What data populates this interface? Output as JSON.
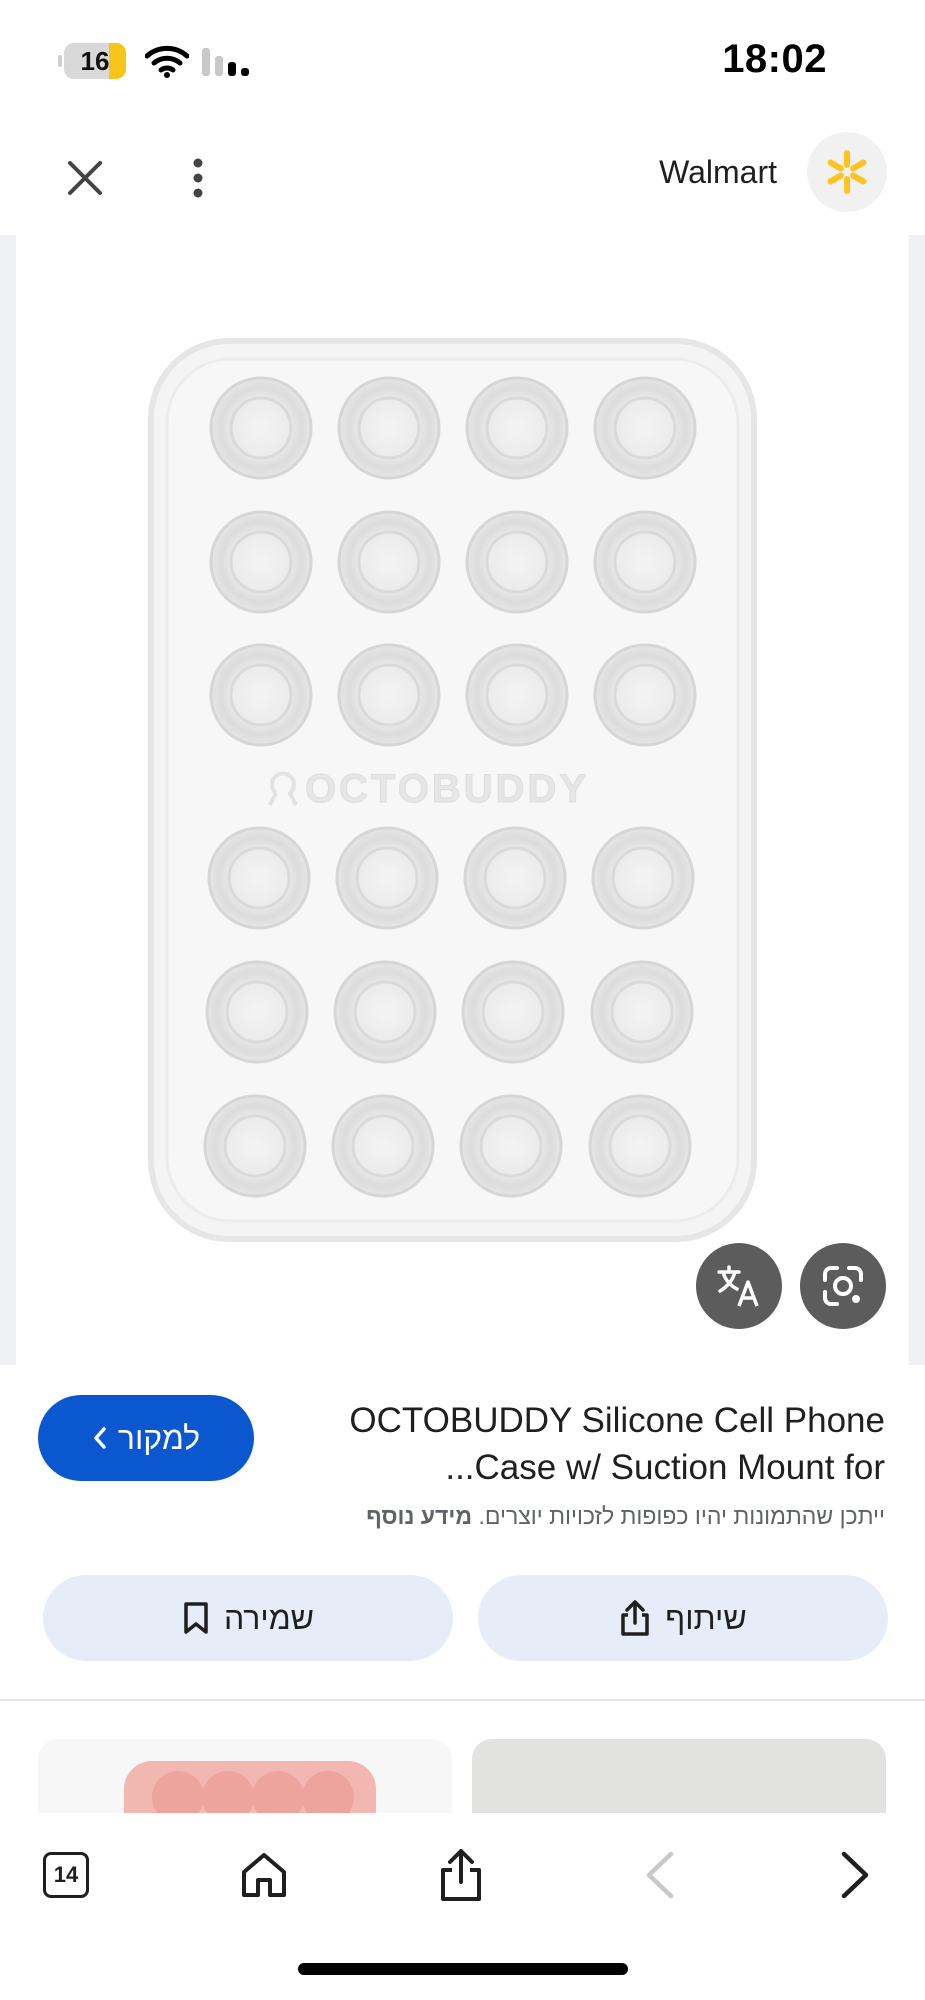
{
  "status_bar": {
    "battery_level": "16",
    "time": "18:02"
  },
  "header": {
    "source_name": "Walmart",
    "close_icon": "close-icon",
    "more_icon": "more-vert-icon",
    "logo_icon": "walmart-spark-icon"
  },
  "image": {
    "brand_text": "OCTOBUDDY",
    "translate_icon": "translate-icon",
    "lens_icon": "google-lens-icon"
  },
  "product": {
    "title_line1": "OCTOBUDDY Silicone Cell Phone",
    "title_line2": "...Case w/ Suction Mount for",
    "visit_label": "למקור",
    "disclaimer_text": "ייתכן שהתמונות יהיו כפופות לזכויות יוצרים.",
    "disclaimer_link": "מידע נוסף",
    "save_label": "שמירה",
    "share_label": "שיתוף"
  },
  "toolbar": {
    "tabs_count": "14",
    "home_icon": "home-icon",
    "share_icon": "share-icon",
    "back_icon": "chevron-left-icon",
    "forward_icon": "chevron-right-icon"
  },
  "colors": {
    "accent": "#0b57d0",
    "pill_bg": "#e6ecf8",
    "battery_low": "#f5c518",
    "walmart_spark": "#ffc220"
  }
}
